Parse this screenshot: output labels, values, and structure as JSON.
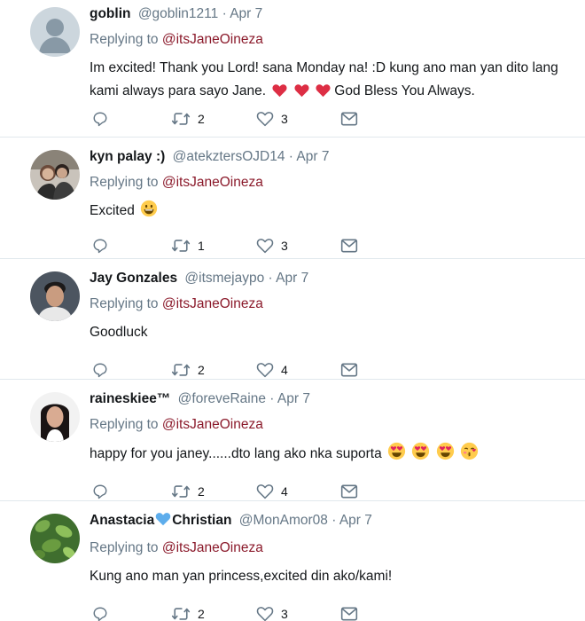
{
  "tweets": [
    {
      "name": "goblin",
      "handle": "@goblin1211",
      "separator": "·",
      "date": "Apr 7",
      "replying_prefix": "Replying to",
      "replying_to": "@itsJaneOineza",
      "text_part1": "Im excited! Thank you Lord! sana Monday na! :D kung ano man yan dito lang kami always para sayo Jane.",
      "text_part2": "God Bless You Always.",
      "retweets": "2",
      "likes": "3"
    },
    {
      "name": "kyn palay :)",
      "handle": "@atekztersOJD14",
      "separator": "·",
      "date": "Apr 7",
      "replying_prefix": "Replying to",
      "replying_to": "@itsJaneOineza",
      "text": "Excited",
      "retweets": "1",
      "likes": "3"
    },
    {
      "name": "Jay Gonzales",
      "handle": "@itsmejaypo",
      "separator": "·",
      "date": "Apr 7",
      "replying_prefix": "Replying to",
      "replying_to": "@itsJaneOineza",
      "text": "Goodluck",
      "retweets": "2",
      "likes": "4"
    },
    {
      "name": "raineskiee™",
      "handle": "@foreveRaine",
      "separator": "·",
      "date": "Apr 7",
      "replying_prefix": "Replying to",
      "replying_to": "@itsJaneOineza",
      "text": "happy for you janey......dto lang ako nka suporta",
      "retweets": "2",
      "likes": "4"
    },
    {
      "name_part1": "Anastacia",
      "name_part2": "Christian",
      "handle": "@MonAmor08",
      "separator": "·",
      "date": "Apr 7",
      "replying_prefix": "Replying to",
      "replying_to": "@itsJaneOineza",
      "text": "Kung ano man yan princess,excited din ako/kami!",
      "retweets": "2",
      "likes": "3"
    }
  ],
  "colors": {
    "mention": "#8b1a2b",
    "secondary_text": "#657786",
    "divider": "#e1e8ed",
    "heart": "#e0245e"
  }
}
